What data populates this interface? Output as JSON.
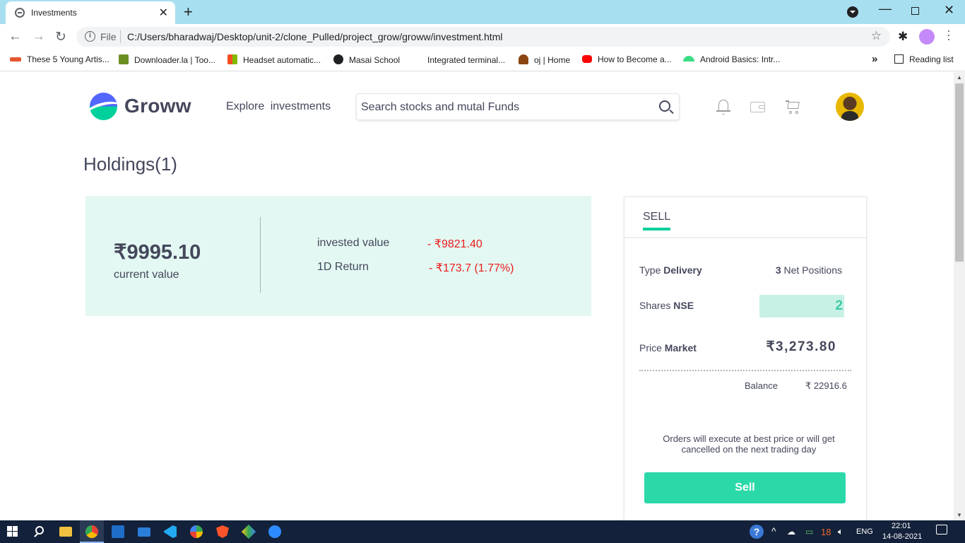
{
  "browser": {
    "tab_title": "Investments",
    "tab_close": "✕",
    "new_tab": "+",
    "url_scheme": "File",
    "url": "C:/Users/bharadwaj/Desktop/unit-2/clone_Pulled/project_grow/groww/investment.html",
    "bookmarks": [
      {
        "label": "These 5 Young Artis...",
        "color": "#e4572e"
      },
      {
        "label": "Downloader.la | Too...",
        "color": "#6b8e23"
      },
      {
        "label": "Headset automatic...",
        "color": "#f25022"
      },
      {
        "label": "Masai School",
        "color": "#202124"
      },
      {
        "label": "Integrated terminal...",
        "color": "#ffffff"
      },
      {
        "label": "oj | Home",
        "color": "#8b4513"
      },
      {
        "label": "How to Become a...",
        "color": "#ff0000"
      },
      {
        "label": "Android Basics: Intr...",
        "color": "#3ddc84"
      }
    ],
    "bookmarks_more": "»",
    "reading_list": "Reading list"
  },
  "header": {
    "brand": "Groww",
    "explore": "Explore  investments",
    "search_placeholder": "Search stocks and mutal Funds",
    "icons": [
      "bell-icon",
      "wallet-icon",
      "cart-icon"
    ]
  },
  "holdings": {
    "title": "Holdings(1)",
    "current_value": "₹9995.10",
    "current_label": "current value",
    "invested_label": "invested value",
    "invested_value": "- ₹9821.40",
    "return_label": "1D Return",
    "return_value": "- ₹173.7 (1.77%)"
  },
  "sell": {
    "tab": "SELL",
    "type_label": "Type",
    "type_value": "Delivery",
    "net_count": "3",
    "net_label": "Net Positions",
    "shares_label": "Shares",
    "shares_exchange": "NSE",
    "shares_value": "2",
    "price_label": "Price",
    "price_type": "Market",
    "price_value": "₹3,273.80",
    "balance_label": "Balance",
    "balance_value": "₹ 22916.6",
    "note": "Orders will execute at best price or will get cancelled on the next trading day",
    "button": "Sell"
  },
  "taskbar": {
    "lang": "ENG",
    "battery": "18",
    "time": "22:01",
    "date": "14-08-2021"
  },
  "colors": {
    "accent": "#00d09c",
    "sell_button": "#2bd9a8",
    "negative": "#eb1c1c",
    "card_bg": "#e3f8f2"
  }
}
